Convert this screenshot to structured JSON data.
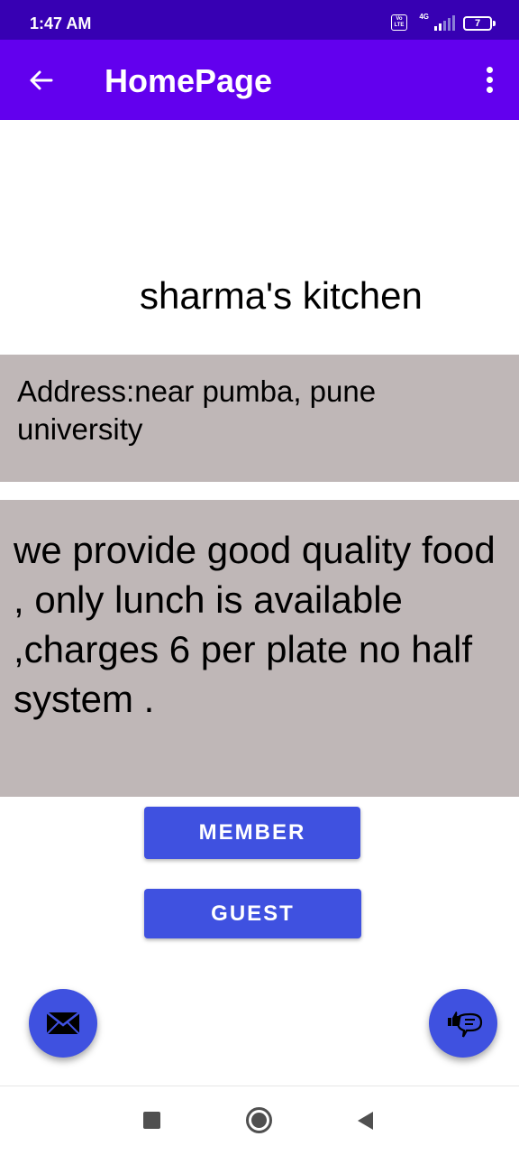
{
  "status_bar": {
    "time": "1:47 AM",
    "volte_label": "Vo LTE",
    "network_label": "4G",
    "battery_level": "7",
    "icons": [
      "volte-icon",
      "signal-icon",
      "battery-icon"
    ]
  },
  "app_bar": {
    "title": "HomePage",
    "back_icon": "arrow-left-icon",
    "menu_icon": "more-vert-icon",
    "background": "#6200ee"
  },
  "kitchen": {
    "name": "sharma's kitchen",
    "address": "Address:near pumba, pune university",
    "description": "we provide good quality food , only lunch is available ,charges 6 per plate no half system ."
  },
  "buttons": {
    "member_label": "MEMBER",
    "guest_label": "GUEST",
    "color": "#3f51e0"
  },
  "fabs": {
    "left_icon": "mail-icon",
    "right_icon": "feedback-thumbs-up-icon"
  },
  "nav": {
    "recents_icon": "square-icon",
    "home_icon": "circle-icon",
    "back_icon": "triangle-back-icon"
  },
  "colors": {
    "status_bar": "#3700b3",
    "app_bar": "#6200ee",
    "panel": "#bfb7b7",
    "accent": "#3f51e0"
  }
}
